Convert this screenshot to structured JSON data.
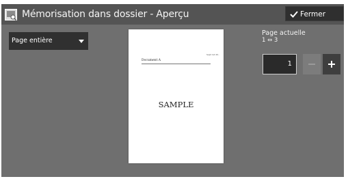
{
  "window": {
    "title": "Mémorisation dans dossier - Aperçu",
    "close_label": "Fermer"
  },
  "view_select": {
    "selected": "Page entière"
  },
  "preview": {
    "doc_date": "Sept 1st 20..",
    "doc_heading": "Document A",
    "watermark": "SAMPLE"
  },
  "pager": {
    "label": "Page actuelle",
    "range": "1 ⇔ 3",
    "current": "1"
  },
  "colors": {
    "background": "#6f6f6f",
    "titlebar": "#545454",
    "button": "#2f2f2f"
  }
}
